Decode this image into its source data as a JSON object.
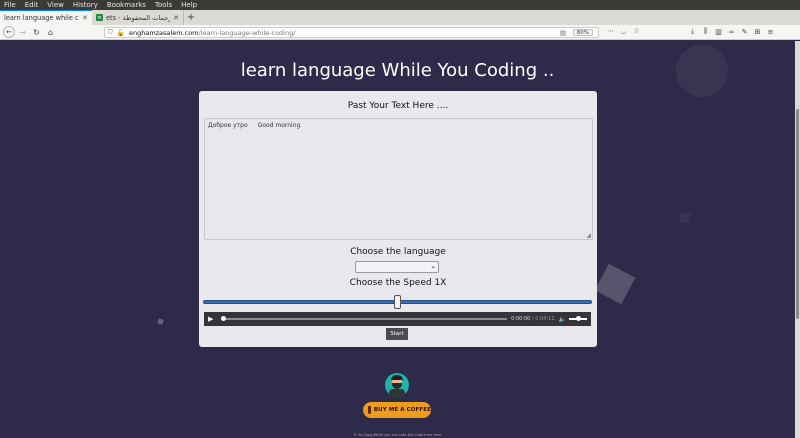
{
  "menubar": [
    "File",
    "Edit",
    "View",
    "History",
    "Bookmarks",
    "Tools",
    "Help"
  ],
  "tabs": [
    {
      "label": "learn language while coding",
      "active": true
    },
    {
      "label": "ets - الترجمات المحفوظة",
      "active": false
    }
  ],
  "url": {
    "host": "enghamzasalem.com",
    "path": "/learn-language-while-coding/",
    "zoom": "80%"
  },
  "page": {
    "heading": "learn language While You Coding ..",
    "card_title": "Past Your Text Here ....",
    "text_source": "Доброе утро",
    "text_translation": "Good morning",
    "language_label": "Choose the language",
    "language_selected": "",
    "speed_label": "Choose the Speed 1X",
    "speed_value": 0.5,
    "audio": {
      "current": "0:00:00",
      "duration": "/ 0:04:11"
    },
    "start_label": "Start",
    "coffee_label": "BUY ME A COFFEE",
    "footer": "© So Copy/Write you can take the code from here"
  },
  "colors": {
    "page_bg": "#2e2b4a",
    "card_bg": "#e9e8ed",
    "slider_track": "#3a6fb7",
    "coffee_button": "#ef9b1e",
    "tab_accent": "#0a84ff"
  }
}
